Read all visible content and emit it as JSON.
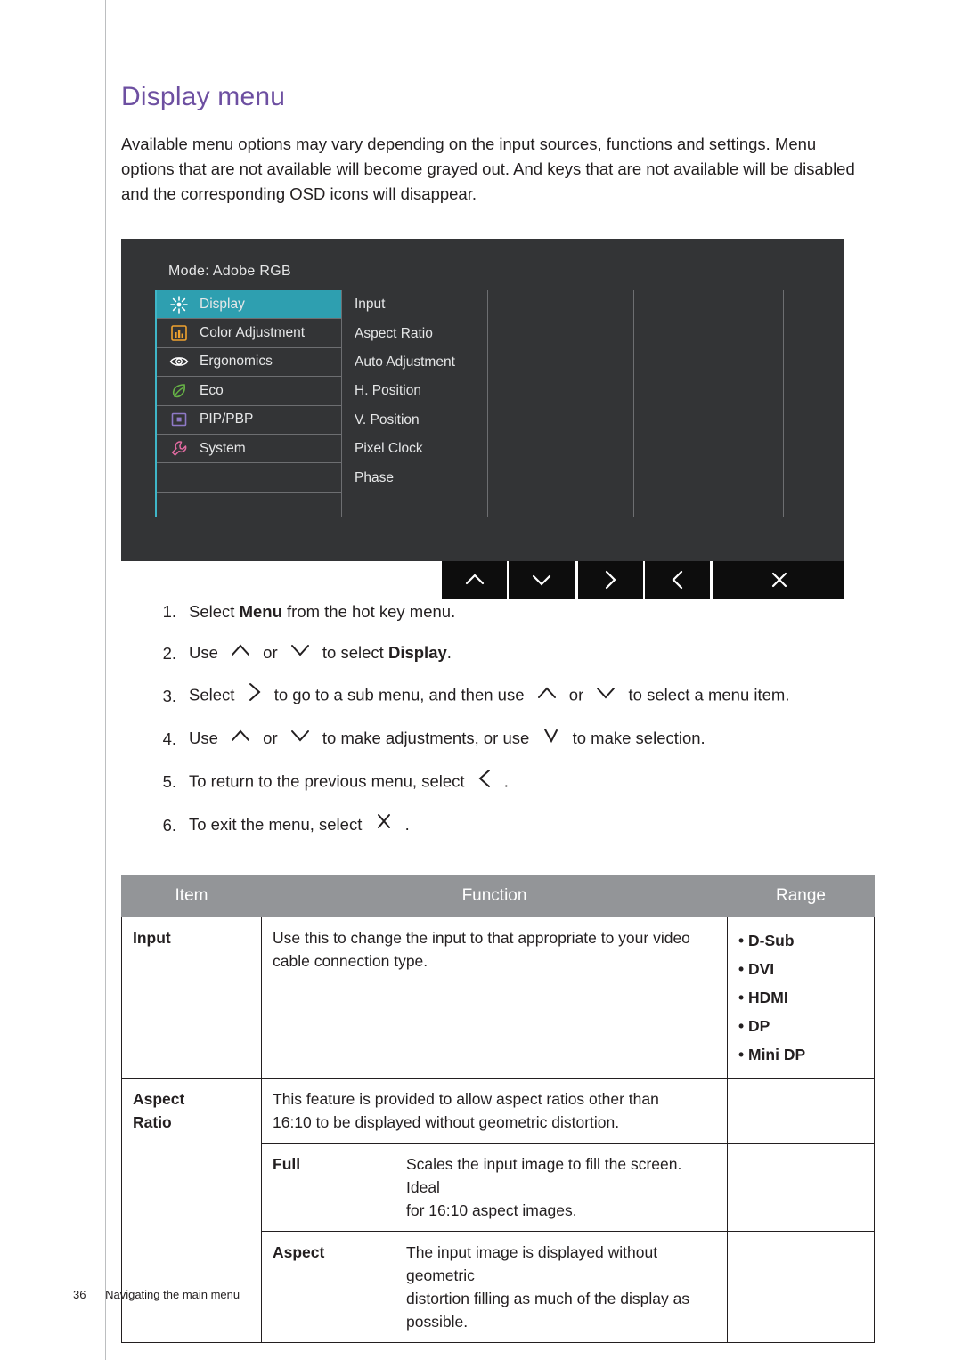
{
  "page": {
    "title": "Display menu",
    "intro": "Available menu options may vary depending on the input sources, functions and settings. Menu options that are not available will become grayed out. And keys that are not available will be disabled and the corresponding OSD icons will disappear.",
    "footer_page": "36",
    "footer_text": "Navigating the main menu"
  },
  "osd": {
    "mode_label": "Mode: Adobe RGB",
    "menu_items": [
      {
        "label": "Display",
        "icon": "display-icon",
        "selected": true
      },
      {
        "label": "Color Adjustment",
        "icon": "color-adjustment-icon",
        "selected": false
      },
      {
        "label": "Ergonomics",
        "icon": "ergonomics-eye-icon",
        "selected": false
      },
      {
        "label": "Eco",
        "icon": "eco-leaf-icon",
        "selected": false
      },
      {
        "label": "PIP/PBP",
        "icon": "pip-pbp-icon",
        "selected": false
      },
      {
        "label": "System",
        "icon": "system-wrench-icon",
        "selected": false
      },
      {
        "label": "",
        "icon": "",
        "selected": false
      },
      {
        "label": "",
        "icon": "",
        "selected": false
      }
    ],
    "sub_items": [
      "Input",
      "Aspect Ratio",
      "Auto Adjustment",
      "H. Position",
      "V. Position",
      "Pixel Clock",
      "Phase"
    ],
    "keys": [
      {
        "name": "up-key",
        "glyph": "∧"
      },
      {
        "name": "down-key",
        "glyph": "∨"
      },
      {
        "name": "right-key",
        "glyph": "›"
      },
      {
        "name": "left-key",
        "glyph": "‹"
      },
      {
        "name": "exit-key",
        "glyph": "✕"
      }
    ]
  },
  "steps": [
    {
      "num": "1.",
      "parts": [
        {
          "t": "text",
          "v": "Select "
        },
        {
          "t": "bold",
          "v": "Menu"
        },
        {
          "t": "text",
          "v": " from the hot key menu."
        }
      ]
    },
    {
      "num": "2.",
      "parts": [
        {
          "t": "text",
          "v": "Use "
        },
        {
          "t": "glyph",
          "v": "up"
        },
        {
          "t": "text",
          "v": " or "
        },
        {
          "t": "glyph",
          "v": "down"
        },
        {
          "t": "text",
          "v": " to select "
        },
        {
          "t": "bold",
          "v": "Display"
        },
        {
          "t": "text",
          "v": "."
        }
      ]
    },
    {
      "num": "3.",
      "parts": [
        {
          "t": "text",
          "v": "Select "
        },
        {
          "t": "glyph",
          "v": "right"
        },
        {
          "t": "text",
          "v": " to go to a sub menu, and then use "
        },
        {
          "t": "glyph",
          "v": "up"
        },
        {
          "t": "text",
          "v": " or "
        },
        {
          "t": "glyph",
          "v": "down"
        },
        {
          "t": "text",
          "v": " to select a menu item."
        }
      ]
    },
    {
      "num": "4.",
      "parts": [
        {
          "t": "text",
          "v": "Use "
        },
        {
          "t": "glyph",
          "v": "up"
        },
        {
          "t": "text",
          "v": " or "
        },
        {
          "t": "glyph",
          "v": "down"
        },
        {
          "t": "text",
          "v": " to make adjustments, or use "
        },
        {
          "t": "glyph",
          "v": "check"
        },
        {
          "t": "text",
          "v": " to make selection."
        }
      ]
    },
    {
      "num": "5.",
      "parts": [
        {
          "t": "text",
          "v": "To return to the previous menu, select "
        },
        {
          "t": "glyph",
          "v": "left"
        },
        {
          "t": "text",
          "v": " ."
        }
      ]
    },
    {
      "num": "6.",
      "parts": [
        {
          "t": "text",
          "v": "To exit the menu, select "
        },
        {
          "t": "glyph",
          "v": "cross"
        },
        {
          "t": "text",
          "v": " ."
        }
      ]
    }
  ],
  "table": {
    "headers": [
      "Item",
      "Function",
      "Range"
    ],
    "rows": {
      "input": {
        "item": "Input",
        "function_l1": "Use this to change the input to that appropriate to your video",
        "function_l2": "cable connection type.",
        "range": [
          "• D-Sub",
          "• DVI",
          "• HDMI",
          "• DP",
          "• Mini DP"
        ]
      },
      "aspect_ratio": {
        "item_l1": "Aspect",
        "item_l2": "Ratio",
        "function_l1": "This feature is provided to allow aspect ratios other than",
        "function_l2": "16:10 to be displayed without geometric distortion."
      },
      "full": {
        "sub": "Full",
        "function_l1": "Scales the input image to fill the screen. Ideal",
        "function_l2": "for 16:10 aspect images."
      },
      "aspect": {
        "sub": "Aspect",
        "function_l1": "The input image is displayed without geometric",
        "function_l2": "distortion filling as much of the display as",
        "function_l3": "possible."
      }
    }
  },
  "colors": {
    "title": "#6d4fa1",
    "osd_bg": "#333436",
    "osd_highlight": "#2e9fb0",
    "header_gray": "#939598"
  }
}
